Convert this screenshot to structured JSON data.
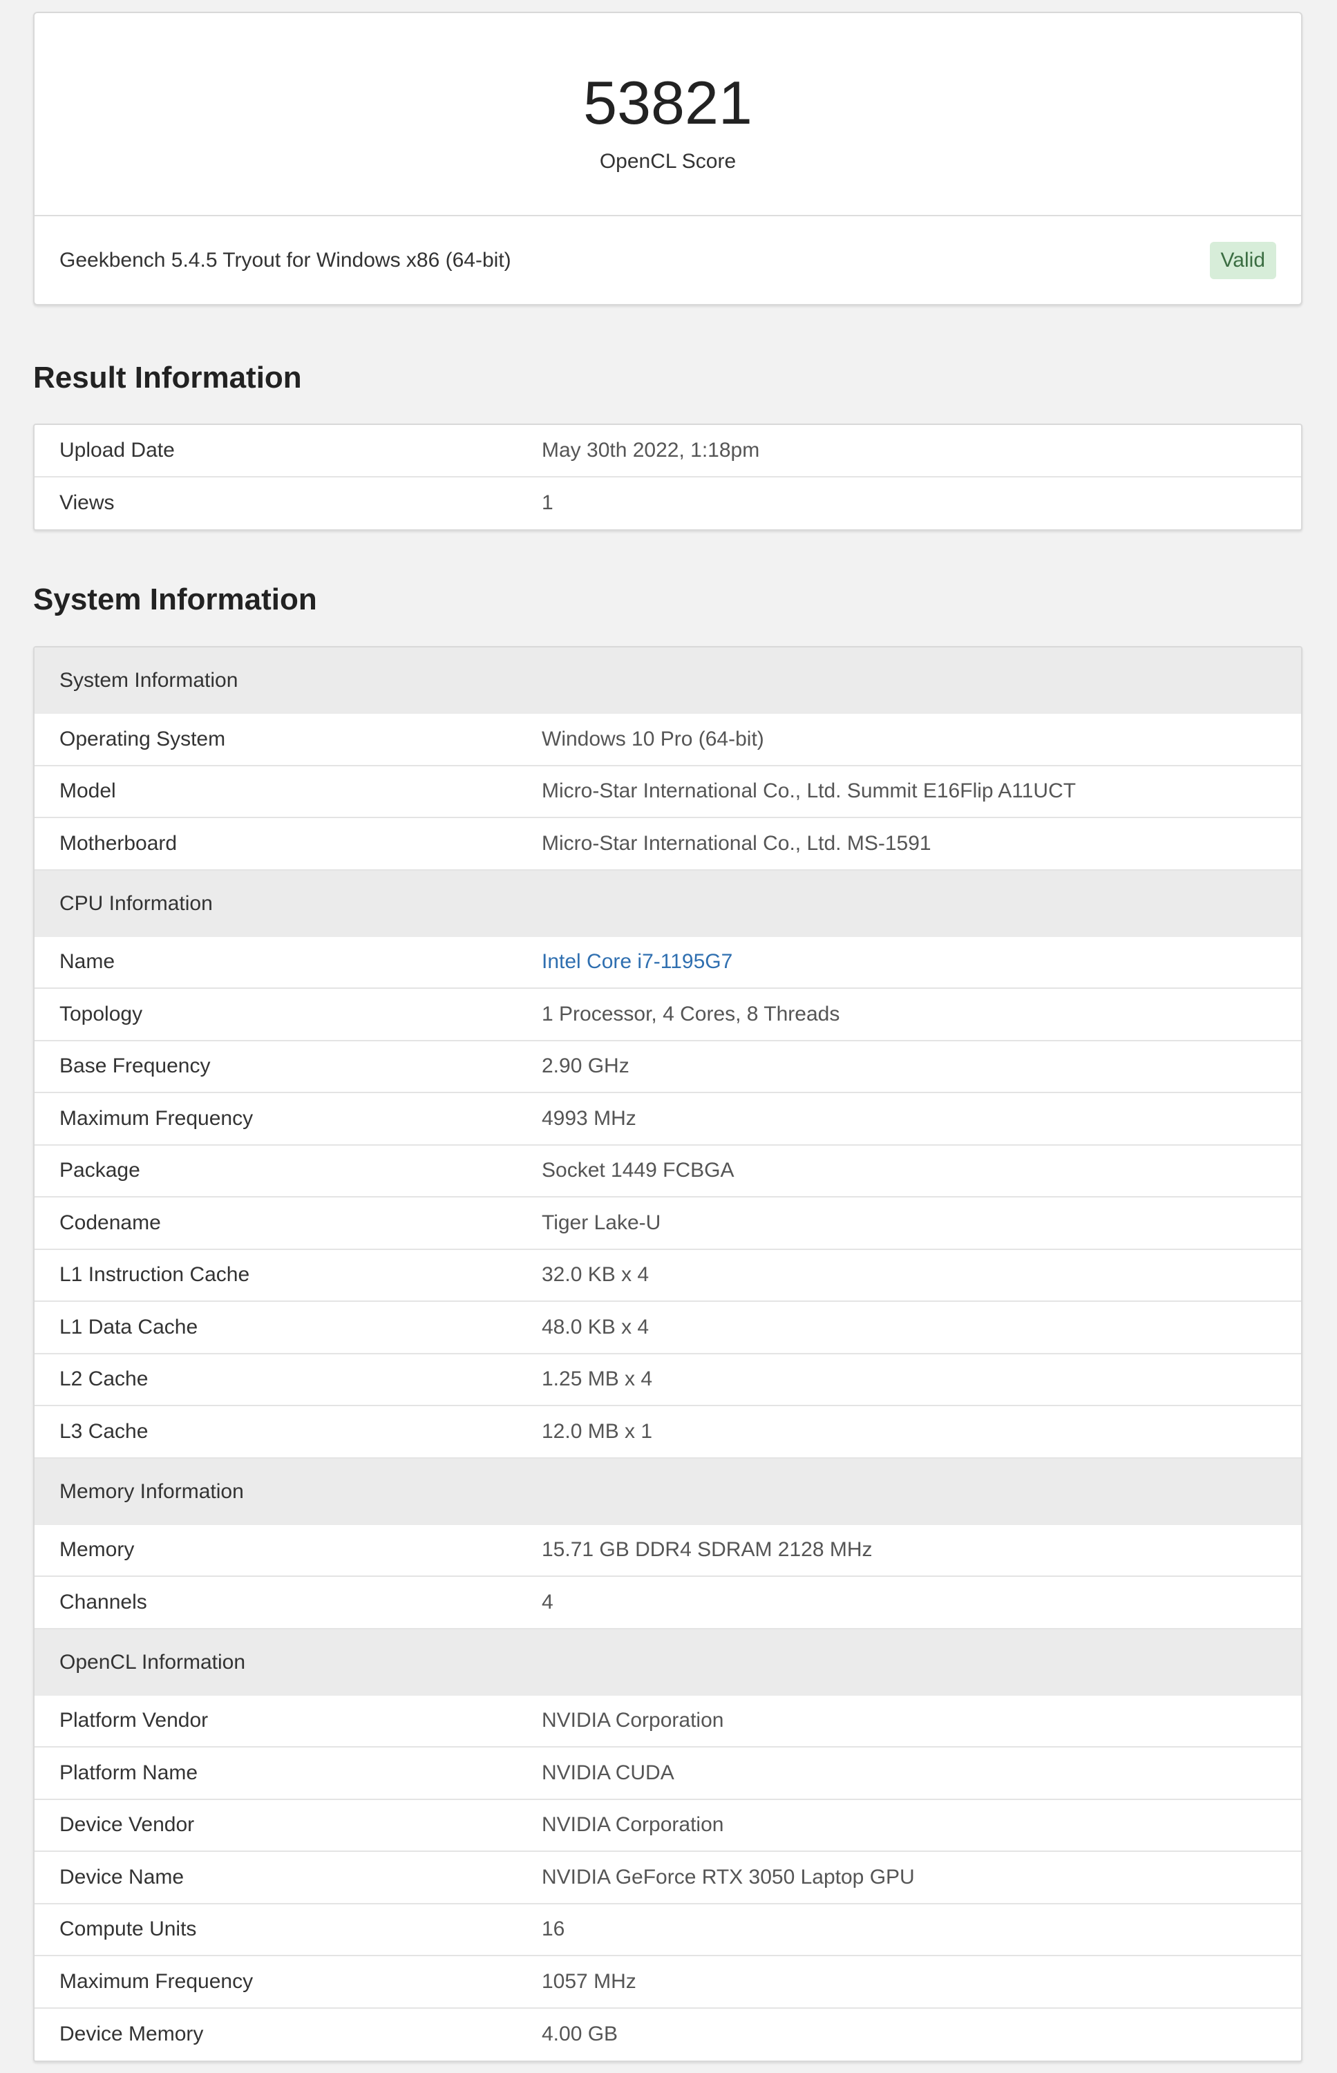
{
  "score": {
    "value": "53821",
    "label": "OpenCL Score",
    "version": "Geekbench 5.4.5 Tryout for Windows x86 (64-bit)",
    "status": "Valid"
  },
  "result_info": {
    "title": "Result Information",
    "rows": [
      {
        "key": "Upload Date",
        "value": "May 30th 2022, 1:18pm"
      },
      {
        "key": "Views",
        "value": "1"
      }
    ]
  },
  "system_info": {
    "title": "System Information",
    "groups": [
      {
        "label": "System Information",
        "rows": [
          {
            "key": "Operating System",
            "value": "Windows 10 Pro (64-bit)"
          },
          {
            "key": "Model",
            "value": "Micro-Star International Co., Ltd. Summit E16Flip A11UCT"
          },
          {
            "key": "Motherboard",
            "value": "Micro-Star International Co., Ltd. MS-1591"
          }
        ]
      },
      {
        "label": "CPU Information",
        "rows": [
          {
            "key": "Name",
            "value": "Intel Core i7-1195G7",
            "link": true
          },
          {
            "key": "Topology",
            "value": "1 Processor, 4 Cores, 8 Threads"
          },
          {
            "key": "Base Frequency",
            "value": "2.90 GHz"
          },
          {
            "key": "Maximum Frequency",
            "value": "4993 MHz"
          },
          {
            "key": "Package",
            "value": "Socket 1449 FCBGA"
          },
          {
            "key": "Codename",
            "value": "Tiger Lake-U"
          },
          {
            "key": "L1 Instruction Cache",
            "value": "32.0 KB x 4"
          },
          {
            "key": "L1 Data Cache",
            "value": "48.0 KB x 4"
          },
          {
            "key": "L2 Cache",
            "value": "1.25 MB x 4"
          },
          {
            "key": "L3 Cache",
            "value": "12.0 MB x 1"
          }
        ]
      },
      {
        "label": "Memory Information",
        "rows": [
          {
            "key": "Memory",
            "value": "15.71 GB DDR4 SDRAM 2128 MHz"
          },
          {
            "key": "Channels",
            "value": "4"
          }
        ]
      },
      {
        "label": "OpenCL Information",
        "rows": [
          {
            "key": "Platform Vendor",
            "value": "NVIDIA Corporation"
          },
          {
            "key": "Platform Name",
            "value": "NVIDIA CUDA"
          },
          {
            "key": "Device Vendor",
            "value": "NVIDIA Corporation"
          },
          {
            "key": "Device Name",
            "value": "NVIDIA GeForce RTX 3050 Laptop GPU"
          },
          {
            "key": "Compute Units",
            "value": "16"
          },
          {
            "key": "Maximum Frequency",
            "value": "1057 MHz"
          },
          {
            "key": "Device Memory",
            "value": "4.00 GB"
          }
        ]
      }
    ]
  }
}
